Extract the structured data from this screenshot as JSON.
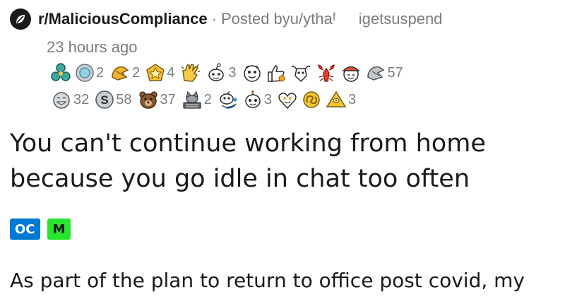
{
  "header": {
    "subreddit": "r/MaliciousCompliance",
    "separator": "·",
    "posted_by_prefix": "Posted by ",
    "author": "u/ythaᶠ",
    "author_tail": "igetsuspend",
    "time_ago": "23 hours ago"
  },
  "awards": {
    "row1": [
      {
        "icon": "triple-gem-award-icon",
        "count": ""
      },
      {
        "icon": "silver-coin-award-icon",
        "count": "2"
      },
      {
        "icon": "hug-award-icon",
        "count": "2"
      },
      {
        "icon": "gold-star-award-icon",
        "count": "4"
      },
      {
        "icon": "clapping-hands-award-icon",
        "count": ""
      },
      {
        "icon": "snoo-award-icon",
        "count": "3"
      },
      {
        "icon": "face-award-icon",
        "count": ""
      },
      {
        "icon": "thumbs-up-award-icon",
        "count": ""
      },
      {
        "icon": "goat-award-icon",
        "count": ""
      },
      {
        "icon": "lobster-award-icon",
        "count": ""
      },
      {
        "icon": "hat-face-award-icon",
        "count": ""
      },
      {
        "icon": "grey-hug-award-icon",
        "count": "57"
      }
    ],
    "row2": [
      {
        "icon": "laughing-face-award-icon",
        "count": "32"
      },
      {
        "icon": "silver-s-award-icon",
        "count": "58"
      },
      {
        "icon": "bear-award-icon",
        "count": "37"
      },
      {
        "icon": "keyboard-cat-award-icon",
        "count": "2"
      },
      {
        "icon": "snoo-splash-award-icon",
        "count": ""
      },
      {
        "icon": "alien-face-award-icon",
        "count": "3"
      },
      {
        "icon": "heart-eyes-award-icon",
        "count": ""
      },
      {
        "icon": "gold-pretzel-award-icon",
        "count": ""
      },
      {
        "icon": "gold-pyramid-award-icon",
        "count": "3"
      }
    ]
  },
  "post": {
    "title": "You can't continue working from home because you go idle in chat too often",
    "flairs": [
      "OC",
      "M"
    ],
    "body_preview": "As part of the plan to return to office post covid, my"
  },
  "colors": {
    "text": "#1a1a1b",
    "meta": "#787c7e",
    "flair_oc": "#0079d3",
    "flair_m": "#27e52c"
  }
}
